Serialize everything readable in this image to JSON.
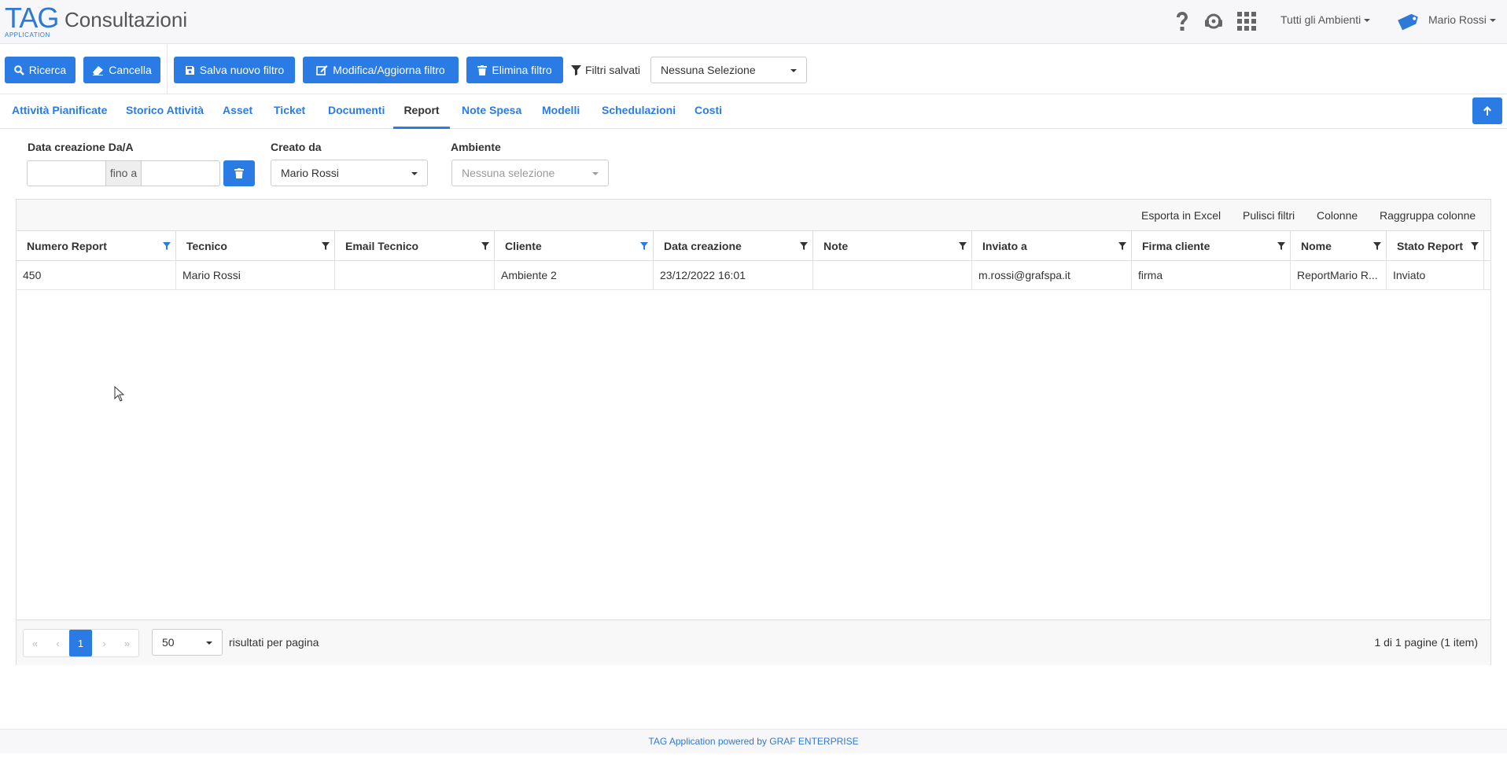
{
  "header": {
    "logo_text": "TAG",
    "logo_sub": "APPLICATION",
    "title": "Consultazioni",
    "env_dropdown": "Tutti gli Ambienti",
    "user_name": "Mario Rossi",
    "avatar_text": "TAG",
    "icons": [
      "help-icon",
      "headset-icon",
      "apps-grid-icon"
    ]
  },
  "toolbar": {
    "search_label": "Ricerca",
    "cancel_label": "Cancella",
    "save_filter_label": "Salva nuovo filtro",
    "edit_filter_label": "Modifica/Aggiorna filtro",
    "delete_filter_label": "Elimina filtro",
    "saved_filters_label": "Filtri salvati",
    "saved_filters_value": "Nessuna Selezione"
  },
  "tabs": [
    {
      "label": "Attività Pianificate",
      "active": false
    },
    {
      "label": "Storico Attività",
      "active": false
    },
    {
      "label": "Asset",
      "active": false
    },
    {
      "label": "Ticket",
      "active": false
    },
    {
      "label": "Documenti",
      "active": false
    },
    {
      "label": "Report",
      "active": true
    },
    {
      "label": "Note Spesa",
      "active": false
    },
    {
      "label": "Modelli",
      "active": false
    },
    {
      "label": "Schedulazioni",
      "active": false
    },
    {
      "label": "Costi",
      "active": false
    }
  ],
  "filters": {
    "date_label": "Data creazione Da/A",
    "date_from": "",
    "date_sep": "fino a",
    "date_to": "",
    "created_by_label": "Creato da",
    "created_by_value": "Mario Rossi",
    "env_label": "Ambiente",
    "env_placeholder": "Nessuna selezione"
  },
  "grid": {
    "toolbar": {
      "export": "Esporta in Excel",
      "clear": "Pulisci filtri",
      "columns": "Colonne",
      "group": "Raggruppa colonne"
    },
    "columns": [
      "Numero Report",
      "Tecnico",
      "Email Tecnico",
      "Cliente",
      "Data creazione",
      "Note",
      "Inviato a",
      "Firma cliente",
      "Nome",
      "Stato Report"
    ],
    "rows": [
      [
        "450",
        "Mario Rossi",
        "",
        "Ambiente 2",
        "23/12/2022 16:01",
        "",
        "m.rossi@grafspa.it",
        "firma",
        "ReportMario R...",
        "Inviato"
      ]
    ],
    "pager": {
      "current_page": "1",
      "page_size": "50",
      "page_size_label": "risultati per pagina",
      "info": "1 di 1 pagine (1 item)"
    }
  },
  "footer": {
    "text": "TAG Application powered by GRAF ENTERPRISE"
  },
  "colors": {
    "primary": "#2b7be5",
    "brand": "#2e78d6"
  }
}
